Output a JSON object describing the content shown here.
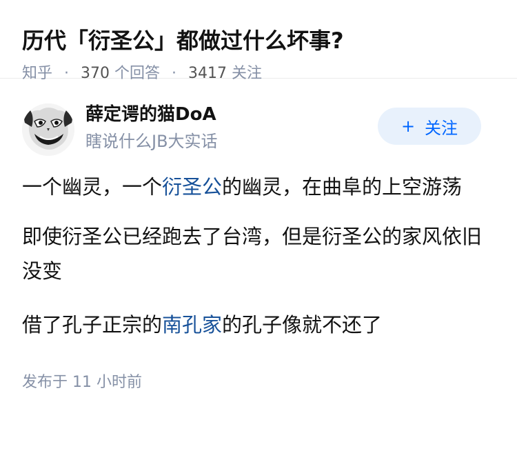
{
  "question": {
    "title": "历代「衍圣公」都做过什么坏事?",
    "source": "知乎",
    "answers_count": "370",
    "answers_label": "个回答",
    "followers_count": "3417",
    "followers_label": "关注"
  },
  "author": {
    "name": "薛定谔的猫DoA",
    "bio": "瞎说什么JB大实话",
    "follow_label": "关注",
    "follow_icon": "plus-icon"
  },
  "answer": {
    "p1_a": "一个幽灵，一个",
    "p1_link": "衍圣公",
    "p1_b": "的幽灵，在曲阜的上空游荡",
    "p2": "即使衍圣公已经跑去了台湾，但是衍圣公的家风依旧没变",
    "p3_a": "借了孔子正宗的",
    "p3_link": "南孔家",
    "p3_b": "的孔子像就不还了",
    "time": "发布于  11 小时前"
  },
  "colors": {
    "link": "#175199",
    "meta": "#8590a6",
    "follow_bg": "#e8f1fc",
    "follow_text": "#0066ff"
  }
}
